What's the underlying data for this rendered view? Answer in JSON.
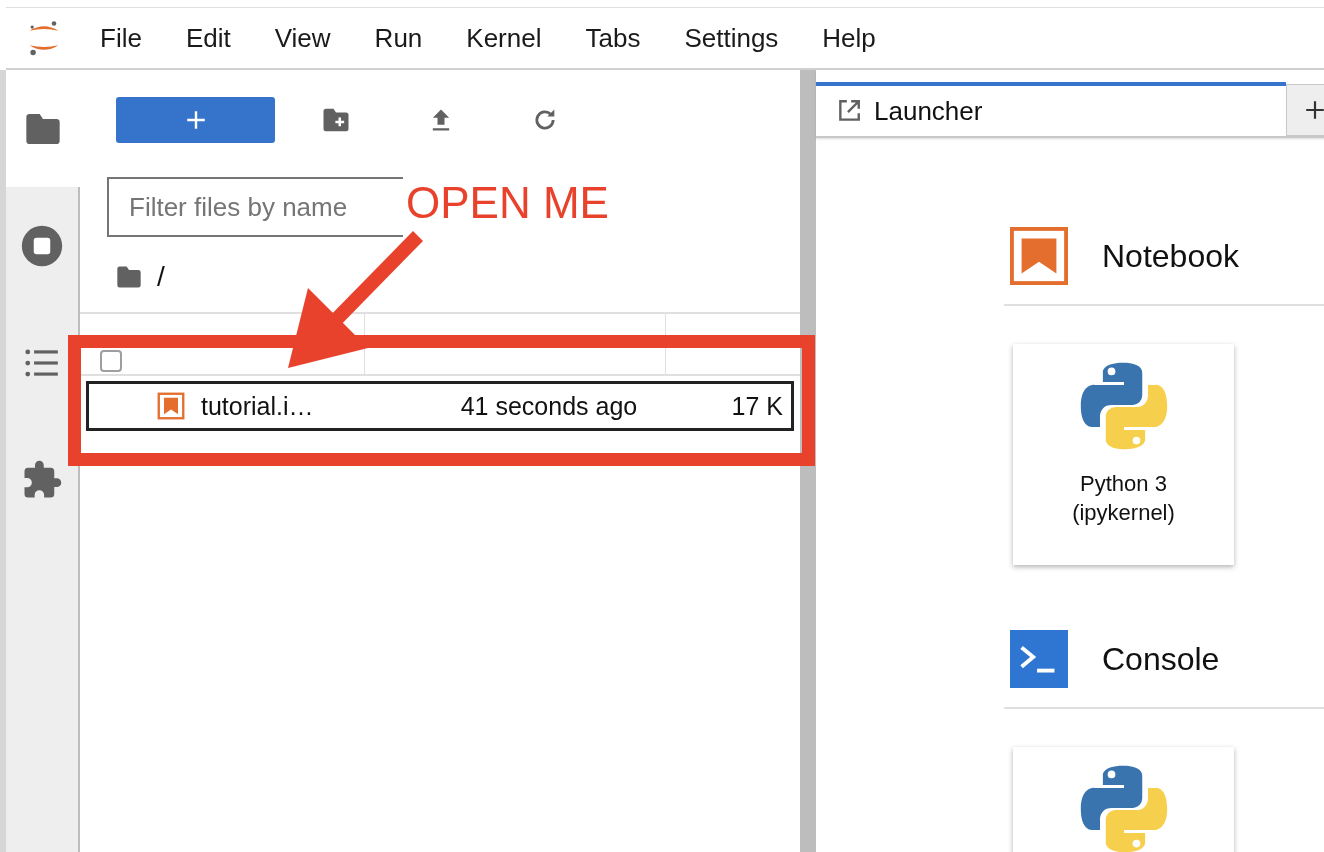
{
  "menu": [
    "File",
    "Edit",
    "View",
    "Run",
    "Kernel",
    "Tabs",
    "Settings",
    "Help"
  ],
  "sidebar_tabs": [
    {
      "kind": "folder",
      "selected": true
    },
    {
      "kind": "running",
      "selected": false
    },
    {
      "kind": "toc",
      "selected": false
    },
    {
      "kind": "extensions",
      "selected": false
    }
  ],
  "file_browser": {
    "filter": {
      "placeholder": "Filter files by name"
    },
    "path": "/",
    "select_all": {
      "checked": false
    },
    "rows": [
      {
        "name": "tutorial.i…",
        "modified": "41 seconds ago",
        "size": "17 K",
        "selected": true
      }
    ]
  },
  "tabs": [
    {
      "title": "Launcher",
      "selected": true
    }
  ],
  "launcher": {
    "sections": [
      {
        "kind": "notebook",
        "title": "Notebook",
        "cards": [
          {
            "kind": "python",
            "label": "Python 3\n(ipykernel)"
          }
        ]
      },
      {
        "kind": "console",
        "title": "Console",
        "cards": [
          {
            "kind": "python"
          }
        ]
      }
    ]
  },
  "annotation": {
    "text": "OPEN ME"
  }
}
